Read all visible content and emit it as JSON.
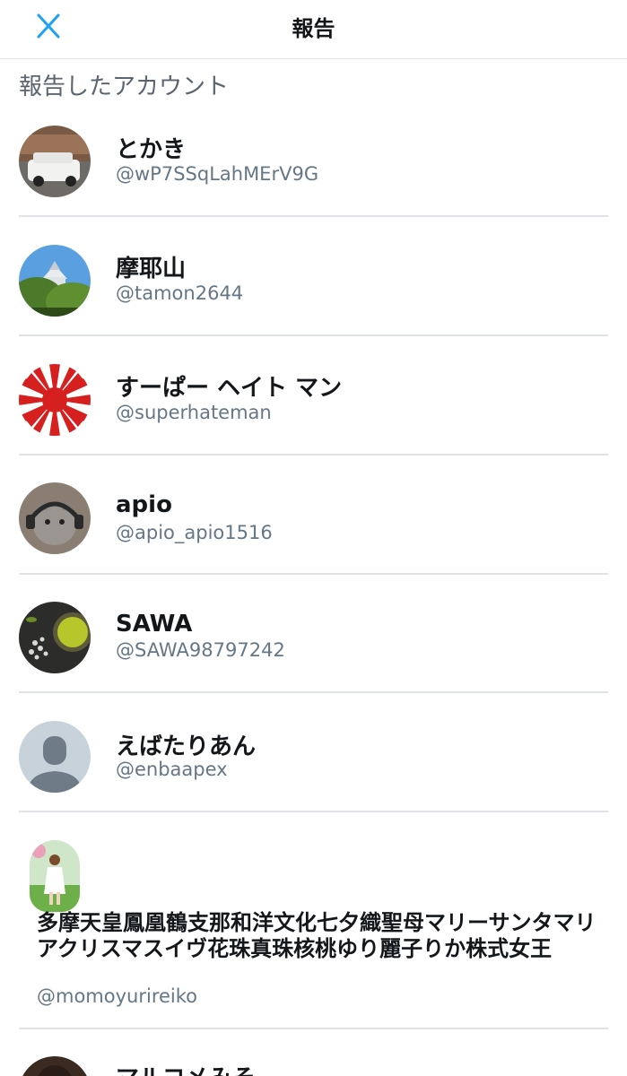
{
  "header": {
    "title": "報告",
    "close_icon": "close-icon"
  },
  "section_label": "報告したアカウント",
  "accounts": [
    {
      "name": "とかき",
      "handle": "@wP7SSqLahMErV9G",
      "avatar": "car-photo"
    },
    {
      "name": "摩耶山",
      "handle": "@tamon2644",
      "avatar": "castle-photo"
    },
    {
      "name": "すーぱー ヘイト マン",
      "handle": "@superhateman",
      "avatar": "rising-sun-flag"
    },
    {
      "name": "apio",
      "handle": "@apio_apio1516",
      "avatar": "cat-headphones-photo"
    },
    {
      "name": "SAWA",
      "handle": "@SAWA98797242",
      "avatar": "green-tea-photo"
    },
    {
      "name": "えばたりあん",
      "handle": "@enbaapex",
      "avatar": "default-profile-icon"
    },
    {
      "name": "多摩天皇鳳凰鶴支那和洋文化七夕織聖母マリーサンタマリアクリスマスイヴ花珠真珠核桃ゆり麗子りか株式女王",
      "handle": "@momoyurireiko",
      "avatar": "doll-photo"
    },
    {
      "name": "マルコメみそ",
      "handle": "",
      "avatar": "dark-photo"
    }
  ],
  "colors": {
    "accent": "#1da1f2",
    "text": "#14171a",
    "secondary": "#657786",
    "divider": "#dfe3e7"
  }
}
